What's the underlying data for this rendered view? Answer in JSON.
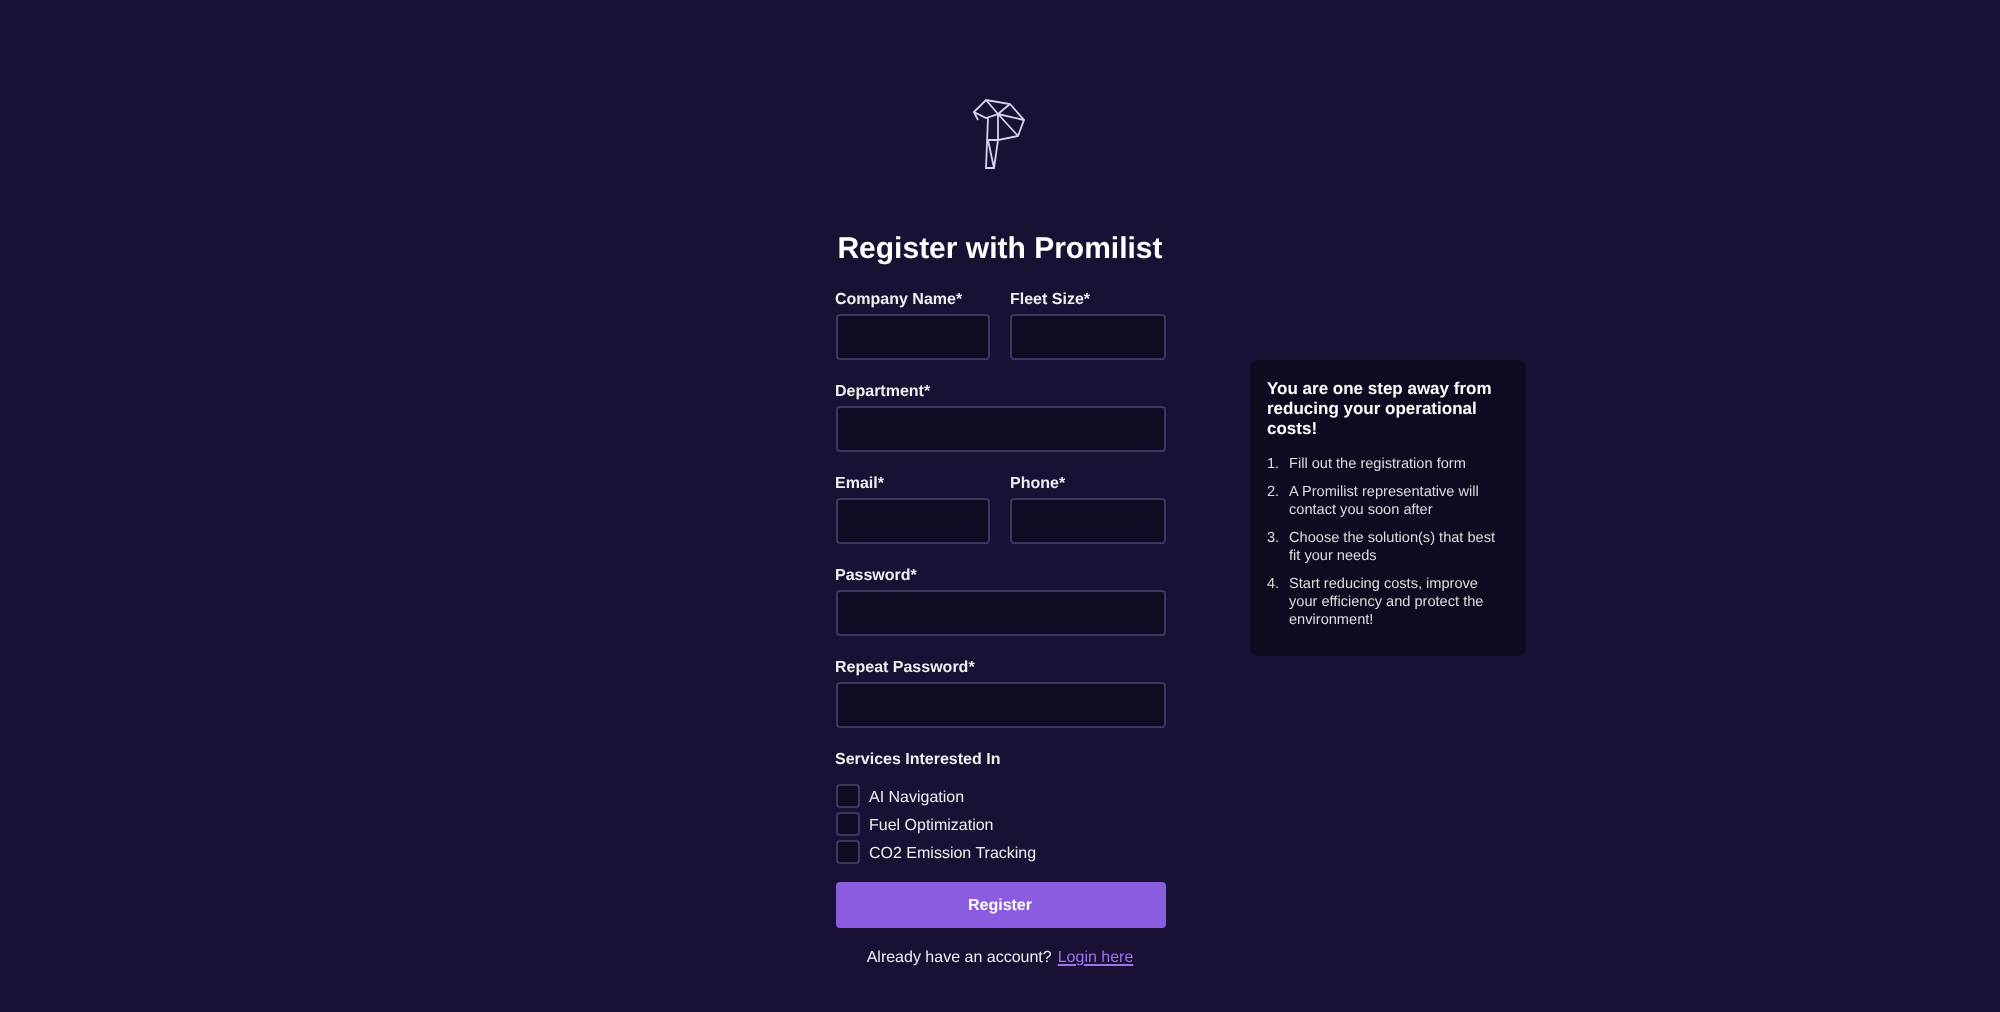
{
  "title": "Register with Promilist",
  "field_rows": [
    {
      "fields": [
        {
          "label": "Company Name*"
        },
        {
          "label": "Fleet Size*"
        }
      ]
    },
    {
      "fields": [
        {
          "label": "Department*"
        }
      ]
    },
    {
      "fields": [
        {
          "label": "Email*"
        },
        {
          "label": "Phone*"
        }
      ]
    },
    {
      "fields": [
        {
          "label": "Password*"
        }
      ]
    },
    {
      "fields": [
        {
          "label": "Repeat Password*"
        }
      ]
    }
  ],
  "services": {
    "label": "Services Interested In",
    "options": [
      {
        "label": "AI Navigation",
        "checked": false
      },
      {
        "label": "Fuel Optimization",
        "checked": false
      },
      {
        "label": "CO2 Emission Tracking",
        "checked": false
      }
    ]
  },
  "submit": "Register",
  "login": {
    "prompt": "Already have an account?",
    "link": "Login here"
  },
  "info": {
    "heading": "You are one step away from reducing your operational costs!",
    "steps": [
      {
        "number": "1.",
        "text": "Fill out the registration form"
      },
      {
        "number": "2.",
        "text": "A Promilist representative will contact you soon after"
      },
      {
        "number": "3.",
        "text": "Choose the solution(s) that best fit your needs"
      },
      {
        "number": "4.",
        "text": "Start reducing costs, improve your efficiency and protect the environment!"
      }
    ]
  }
}
